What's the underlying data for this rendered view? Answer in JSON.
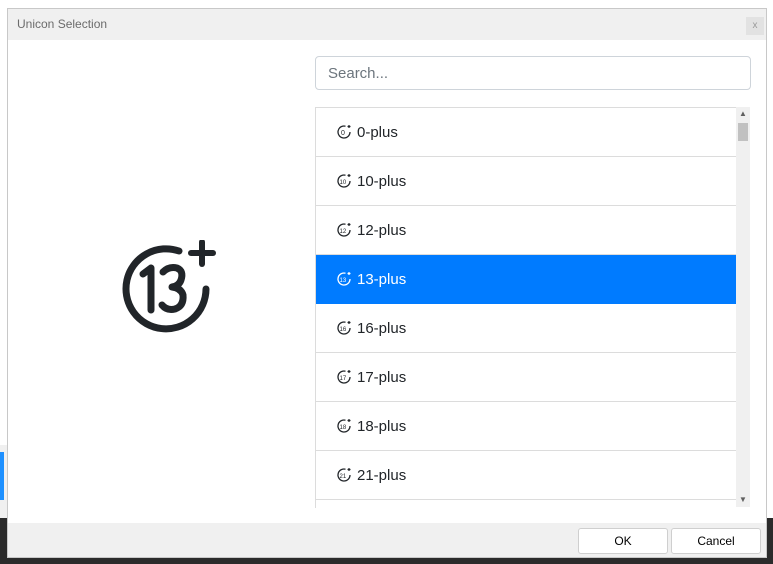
{
  "dialog": {
    "title": "Unicon Selection",
    "close_label": "x"
  },
  "preview": {
    "icon": "13-plus-icon"
  },
  "search": {
    "placeholder": "Search...",
    "value": ""
  },
  "list": {
    "items": [
      {
        "label": "0-plus",
        "icon": "0-plus-icon",
        "selected": false
      },
      {
        "label": "10-plus",
        "icon": "10-plus-icon",
        "selected": false
      },
      {
        "label": "12-plus",
        "icon": "12-plus-icon",
        "selected": false
      },
      {
        "label": "13-plus",
        "icon": "13-plus-icon",
        "selected": true
      },
      {
        "label": "16-plus",
        "icon": "16-plus-icon",
        "selected": false
      },
      {
        "label": "17-plus",
        "icon": "17-plus-icon",
        "selected": false
      },
      {
        "label": "18-plus",
        "icon": "18-plus-icon",
        "selected": false
      },
      {
        "label": "21-plus",
        "icon": "21-plus-icon",
        "selected": false
      },
      {
        "label": "",
        "icon": "",
        "selected": false
      }
    ],
    "selected_color": "#007bff"
  },
  "buttons": {
    "ok": "OK",
    "cancel": "Cancel"
  }
}
